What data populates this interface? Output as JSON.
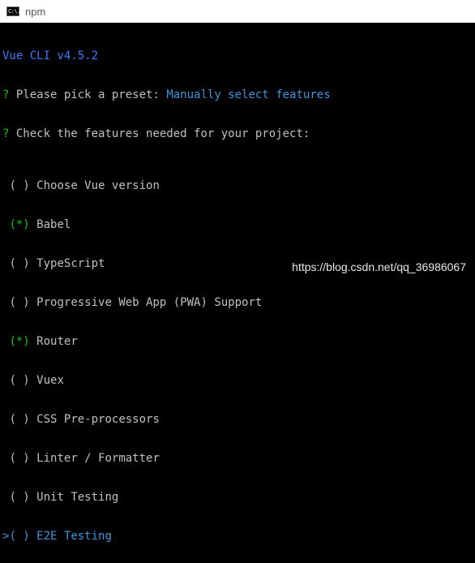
{
  "window": {
    "title": "npm",
    "icon_text": "C:\\."
  },
  "console": {
    "version_line": "Vue CLI v4.5.2",
    "preset": {
      "prefix": "?",
      "question": "Please pick a preset:",
      "answer": "Manually select features"
    },
    "features_prompt": {
      "prefix": "?",
      "question": "Check the features needed for your project:"
    },
    "features": [
      {
        "mark": "( )",
        "label": "Choose Vue version",
        "checked": false
      },
      {
        "mark": "(*)",
        "label": "Babel",
        "checked": true
      },
      {
        "mark": "( )",
        "label": "TypeScript",
        "checked": false
      },
      {
        "mark": "( )",
        "label": "Progressive Web App (PWA) Support",
        "checked": false
      },
      {
        "mark": "(*)",
        "label": "Router",
        "checked": true
      },
      {
        "mark": "( )",
        "label": "Vuex",
        "checked": false
      },
      {
        "mark": "( )",
        "label": "CSS Pre-processors",
        "checked": false
      },
      {
        "mark": "( )",
        "label": "Linter / Formatter",
        "checked": false
      },
      {
        "mark": "( )",
        "label": "Unit Testing",
        "checked": false
      },
      {
        "mark": "( )",
        "label": "E2E Testing",
        "checked": false,
        "cursor": ">"
      }
    ]
  },
  "watermark": "https://blog.csdn.net/qq_36986067",
  "colors": {
    "blue": "#3b78ff",
    "green": "#16c60c",
    "cyan": "#3a96dd",
    "text": "#c0c0c0"
  }
}
